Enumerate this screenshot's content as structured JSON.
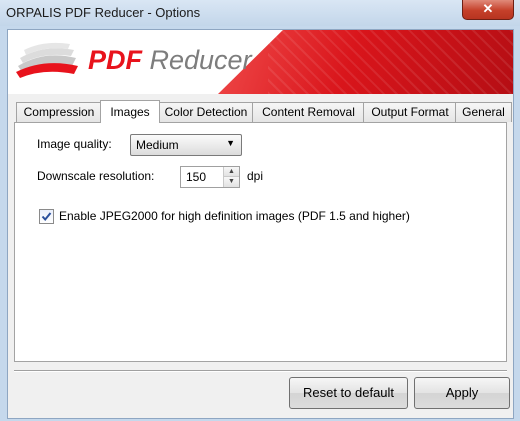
{
  "window": {
    "title": "ORPALIS PDF Reducer - Options",
    "close_glyph": "✕"
  },
  "banner": {
    "logo_icon": "stacked-paper-logo-icon",
    "logo_bold": "PDF",
    "logo_rest": " Reducer",
    "brand_color": "#e8131c"
  },
  "tabs": [
    {
      "label": "Compression",
      "active": false
    },
    {
      "label": "Images",
      "active": true
    },
    {
      "label": "Color Detection",
      "active": false
    },
    {
      "label": "Content Removal",
      "active": false
    },
    {
      "label": "Output Format",
      "active": false
    },
    {
      "label": "General",
      "active": false
    }
  ],
  "images": {
    "quality_label": "Image quality:",
    "quality_value": "Medium",
    "downscale_label": "Downscale resolution:",
    "downscale_value": "150",
    "downscale_unit": "dpi",
    "jpeg2000_label": "Enable JPEG2000 for high definition images (PDF 1.5 and higher)",
    "jpeg2000_checked": true
  },
  "footer": {
    "reset_label": "Reset to default",
    "apply_label": "Apply"
  }
}
